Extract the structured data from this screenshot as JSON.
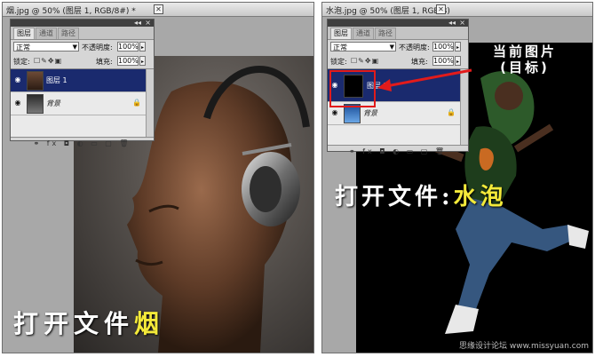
{
  "left": {
    "title": "烟.jpg @ 50% (图层 1, RGB/8#) *",
    "close": "✕",
    "panel": {
      "tabs": [
        "图层",
        "通道",
        "路径"
      ],
      "blend_mode": "正常",
      "opacity_label": "不透明度:",
      "opacity_value": "100%",
      "lock_label": "锁定:",
      "fill_label": "填充:",
      "fill_value": "100%",
      "layers": [
        {
          "name": "图层 1"
        },
        {
          "name": "背景"
        }
      ]
    },
    "caption_white": "打开文件",
    "caption_yellow": "烟"
  },
  "right": {
    "title": "水泡.jpg @ 50% (图层 1, RGB/8)",
    "close": "✕",
    "panel": {
      "tabs": [
        "图层",
        "通道",
        "路径"
      ],
      "blend_mode": "正常",
      "opacity_label": "不透明度:",
      "opacity_value": "100%",
      "lock_label": "锁定:",
      "fill_label": "填充:",
      "fill_value": "100%",
      "layers": [
        {
          "name": "图层 1"
        },
        {
          "name": "背景"
        }
      ]
    },
    "note_line1": "当前图片",
    "note_line2": "(目标)",
    "caption_white": "打开文件:",
    "caption_yellow": "水泡",
    "watermark": "思缘设计论坛 www.missyuan.com"
  }
}
